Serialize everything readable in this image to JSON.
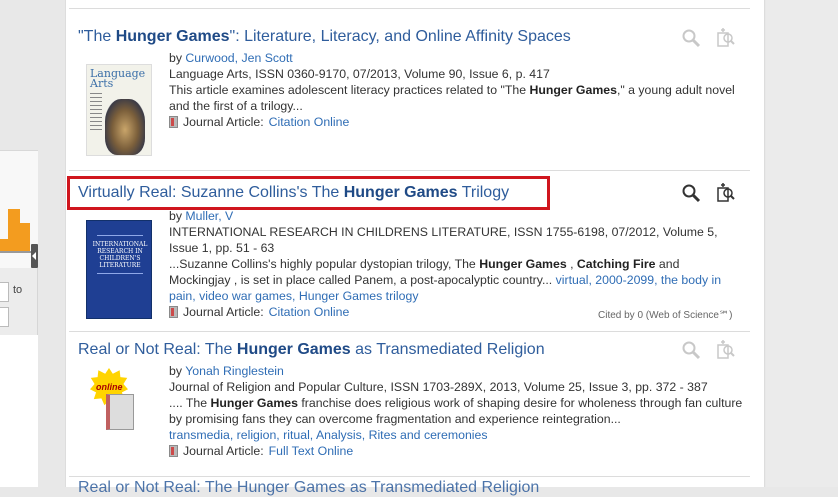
{
  "sidebar": {
    "year_range_separator": "to"
  },
  "results": [
    {
      "title_parts": [
        "\"The ",
        "Hunger Games",
        "\": Literature, Literacy, and Online Affinity Spaces"
      ],
      "by_prefix": "by ",
      "authors": "Curwood, Jen Scott",
      "source": "Language Arts, ISSN 0360-9170, 07/2013, Volume 90, Issue 6, p. 417",
      "snippet_parts": [
        "This article examines adolescent literacy practices related to \"The ",
        "Hunger Games",
        ",\" a young adult novel and the first of a trilogy..."
      ],
      "type_label": "Journal Article:",
      "access_link": "Citation Online",
      "cover_logo": "Language Arts"
    },
    {
      "title_parts": [
        "Virtually Real: Suzanne Collins's The ",
        "Hunger Games",
        " Trilogy"
      ],
      "by_prefix": "by ",
      "authors": "Muller, V",
      "source": "INTERNATIONAL RESEARCH IN CHILDRENS LITERATURE, ISSN 1755-6198, 07/2012, Volume 5, Issue 1, pp. 51 - 63",
      "snippet_parts": [
        "...Suzanne Collins's highly popular dystopian trilogy, The ",
        "Hunger Games",
        " , ",
        "Catching Fire",
        " and Mockingjay , is set in place called Panem, a post-apocalyptic country..."
      ],
      "subjects": "virtual, 2000-2099, the body in pain, video war games, Hunger Games trilogy",
      "type_label": "Journal Article:",
      "access_link": "Citation Online",
      "cited": "Cited by 0 (Web of Science℠)",
      "cover_text": "INTERNATIONAL RESEARCH IN CHILDREN'S LITERATURE"
    },
    {
      "title_parts": [
        "Real or Not Real: The ",
        "Hunger Games",
        " as Transmediated Religion"
      ],
      "by_prefix": "by ",
      "authors": "Yonah Ringlestein",
      "source": "Journal of Religion and Popular Culture, ISSN 1703-289X, 2013, Volume 25, Issue 3, pp. 372 - 387",
      "snippet_parts": [
        ".... The ",
        "Hunger Games",
        " franchise does religious work of shaping desire for wholeness through fan culture by promising fans they can overcome fragmentation and experience reintegration..."
      ],
      "subjects": "transmedia, religion, ritual, Analysis, Rites and ceremonies",
      "type_label": "Journal Article:",
      "access_link": "Full Text Online",
      "badge": "online"
    }
  ],
  "next_title_partial": "Real or Not Real: The Hunger Games as Transmediated Religion",
  "icons": {
    "preview": "magnifier-icon",
    "save": "add-to-folder-icon"
  },
  "colors": {
    "link": "#2f6db5",
    "title": "#2f5d9c",
    "highlight": "#d0161e",
    "histogram": "#f39c1f"
  }
}
